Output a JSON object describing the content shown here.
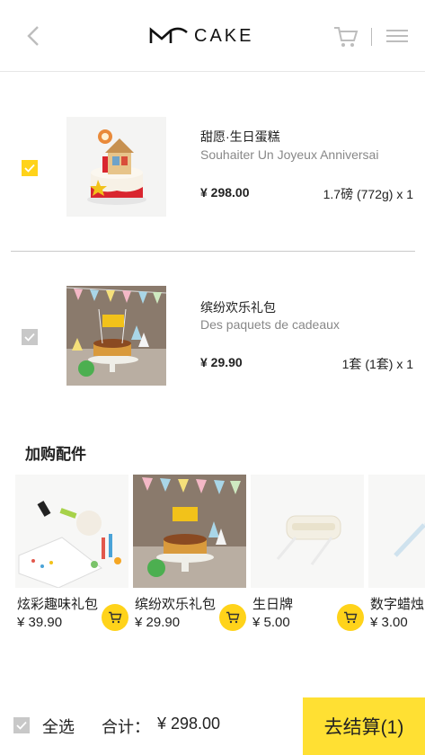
{
  "header": {
    "logo_text": "CAKE",
    "icons": {
      "back": "back-arrow-icon",
      "logo": "mcake-logo",
      "cart": "cart-icon",
      "menu": "menu-icon"
    }
  },
  "cart": {
    "items": [
      {
        "name": "甜愿·生日蛋糕",
        "subtitle": "Souhaiter Un Joyeux Anniversai",
        "price": "¥ 298.00",
        "quantity": "1.7磅 (772g) x 1",
        "checked": true
      },
      {
        "name": "缤纷欢乐礼包",
        "subtitle": "Des paquets de cadeaux",
        "price": "¥ 29.90",
        "quantity": "1套 (1套) x 1",
        "checked": false
      }
    ]
  },
  "accessories": {
    "title": "加购配件",
    "items": [
      {
        "name": "炫彩趣味礼包",
        "price": "¥ 39.90"
      },
      {
        "name": "缤纷欢乐礼包",
        "price": "¥ 29.90"
      },
      {
        "name": "生日牌",
        "price": "¥ 5.00"
      },
      {
        "name": "数字蜡烛",
        "price": "¥ 3.00"
      }
    ]
  },
  "footer": {
    "select_all": "全选",
    "total_label": "合计：",
    "total": "¥ 298.00",
    "checkout": "去结算(1)"
  },
  "colors": {
    "accent": "#ffd31a",
    "checkout_bg": "#ffe033",
    "checkbox_off": "#c8c8c8",
    "subtitle": "#888888"
  }
}
